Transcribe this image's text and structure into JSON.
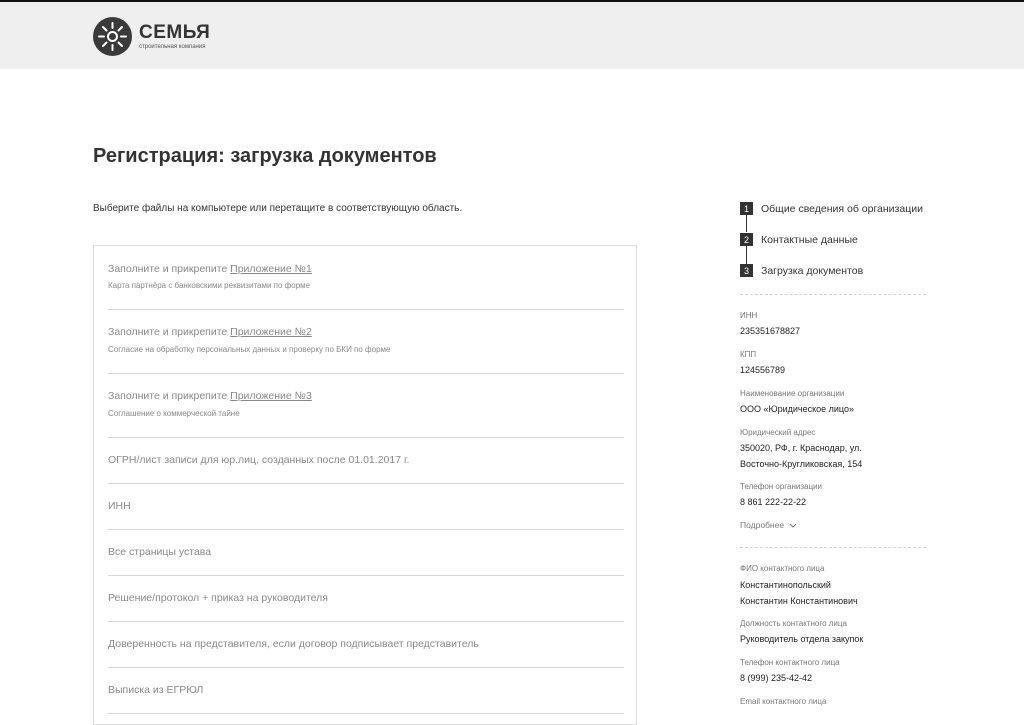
{
  "header": {
    "logo_name": "СЕМЬЯ",
    "logo_tagline": "строительная компания"
  },
  "page": {
    "title": "Регистрация: загрузка документов",
    "hint": "Выберите файлы на компьютере или перетащите в соответствующую область."
  },
  "uploads": [
    {
      "prefix": "Заполните и прикрепите ",
      "link": "Приложение №1",
      "sub": "Карта партнёра с банковскими реквизитами по форме"
    },
    {
      "prefix": "Заполните и прикрепите ",
      "link": "Приложение №2",
      "sub": "Согласие на обработку персональных данных и проверку по БКИ по форме"
    },
    {
      "prefix": "Заполните и прикрепите ",
      "link": "Приложение №3",
      "sub": "Соглашение о коммерческой тайне"
    },
    {
      "text": "ОГРН/лист записи для юр.лиц, созданных после 01.01.2017 г."
    },
    {
      "text": "ИНН"
    },
    {
      "text": "Все страницы устава"
    },
    {
      "text": "Решение/протокол + приказ на руководителя"
    },
    {
      "text": "Доверенность на представителя, если договор подписывает представитель"
    },
    {
      "text": "Выписка из ЕГРЮЛ"
    }
  ],
  "steps": [
    {
      "num": "1",
      "label": "Общие сведения об организации"
    },
    {
      "num": "2",
      "label": "Контактные данные"
    },
    {
      "num": "3",
      "label": "Загрузка документов"
    }
  ],
  "summary": {
    "inn_label": "ИНН",
    "inn_value": "235351678827",
    "kpp_label": "КПП",
    "kpp_value": "124556789",
    "org_label": "Наименование организации",
    "org_value": "ООО «Юридическое лицо»",
    "address_label": "Юридический адрес",
    "address_line1": "350020, РФ, г. Краснодар, ул.",
    "address_line2": "Восточно-Кругликовская, 154",
    "org_phone_label": "Телефон организации",
    "org_phone_value": "8 861 222-22-22",
    "more_label": "Подробнее",
    "contact_name_label": "ФИО контактного лица",
    "contact_name_line1": "Константинопольский",
    "contact_name_line2": "Константин Константинович",
    "contact_position_label": "Должность контактного лица",
    "contact_position_value": "Руководитель отдела закупок",
    "contact_phone_label": "Телефон контактного лица",
    "contact_phone_value": "8 (999) 235-42-42",
    "contact_email_label": "Email контактного лица"
  }
}
